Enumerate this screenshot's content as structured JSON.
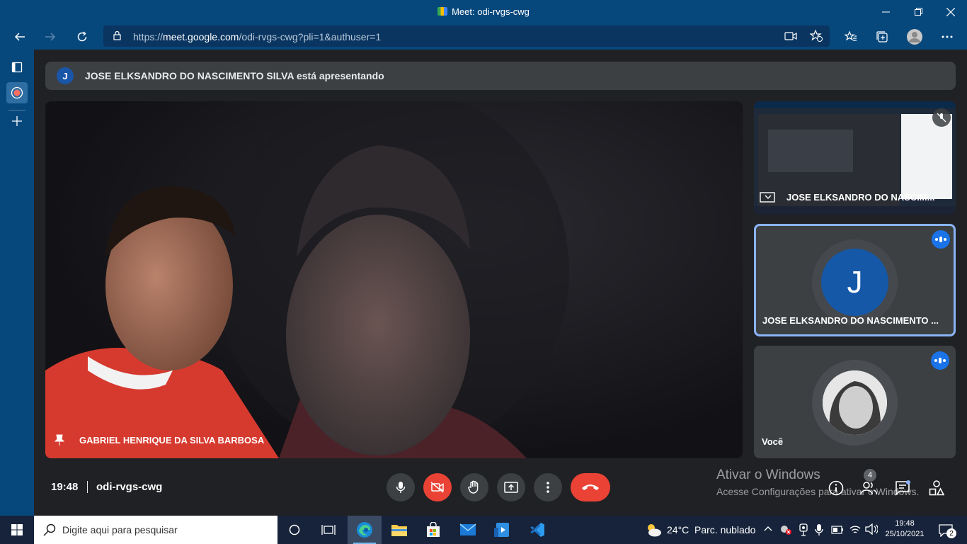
{
  "browser": {
    "title": "Meet: odi-rvgs-cwg",
    "url_prefix": "https://",
    "url_domain": "meet.google.com",
    "url_path": "/odi-rvgs-cwg?pli=1&authuser=1"
  },
  "meet": {
    "banner_initial": "J",
    "banner_text": "JOSE ELKSANDRO DO NASCIMENTO SILVA está apresentando",
    "main_video_name": "GABRIEL HENRIQUE DA SILVA BARBOSA",
    "presentation_tile_name": "JOSE ELKSANDRO DO NASCIM...",
    "participant_tile_initial": "J",
    "participant_tile_name": "JOSE ELKSANDRO DO NASCIMENTO ...",
    "self_tile_name": "Você",
    "time": "19:48",
    "meeting_code": "odi-rvgs-cwg",
    "participants_count": "4"
  },
  "watermark": {
    "line1": "Ativar o Windows",
    "line2": "Acesse Configurações para ativar o Windows."
  },
  "taskbar": {
    "search_placeholder": "Digite aqui para pesquisar",
    "weather_temp": "24°C",
    "weather_desc": "Parc. nublado",
    "clock_time": "19:48",
    "clock_date": "25/10/2021",
    "notification_count": "2"
  },
  "colors": {
    "browser_chrome": "#07487c",
    "meet_bg": "#202124",
    "tile_bg": "#3c4043",
    "danger": "#ea4335",
    "accent": "#1a73e8",
    "active_border": "#8ab4f8"
  }
}
